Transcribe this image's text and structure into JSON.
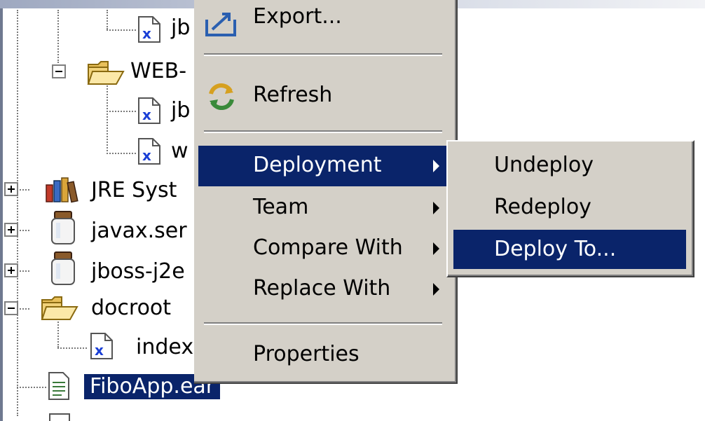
{
  "tree": {
    "items": [
      {
        "label": "jb",
        "name": "tree-item-jboss-xml-1"
      },
      {
        "label": "WEB-",
        "name": "tree-item-web-inf"
      },
      {
        "label": "jb",
        "name": "tree-item-jboss-web-xml"
      },
      {
        "label": "w",
        "name": "tree-item-web-xml"
      },
      {
        "label": "JRE Syst",
        "name": "tree-item-jre-system-library"
      },
      {
        "label": "javax.ser",
        "name": "tree-item-javax-servlet-jar"
      },
      {
        "label": "jboss-j2e",
        "name": "tree-item-jboss-j2ee-jar"
      },
      {
        "label": "docroot",
        "name": "tree-item-docroot"
      },
      {
        "label": "index",
        "name": "tree-item-index"
      },
      {
        "label": "FiboApp.ear",
        "name": "tree-item-fiboapp-ear"
      }
    ]
  },
  "context_menu": {
    "export": "Export...",
    "refresh": "Refresh",
    "deployment": "Deployment",
    "team": "Team",
    "compare_with": "Compare With",
    "replace_with": "Replace With",
    "properties": "Properties"
  },
  "submenu": {
    "undeploy": "Undeploy",
    "redeploy": "Redeploy",
    "deploy_to": "Deploy To..."
  },
  "colors": {
    "selection": "#0a246a",
    "menu_background": "#d4d0c8"
  }
}
